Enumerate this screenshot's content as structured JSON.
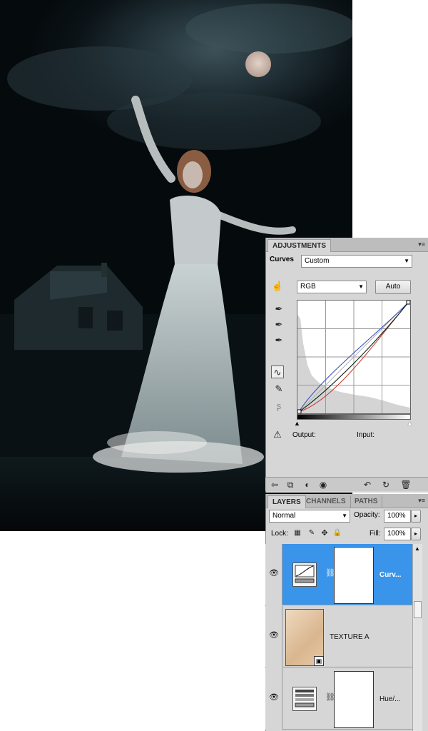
{
  "colors": {
    "panel_bg": "#d6d6d6",
    "selected_layer": "#3a94ea",
    "curve_rgb": "#1a1a1a",
    "curve_red": "#c0392b",
    "curve_green": "#27ae60",
    "curve_blue": "#2e4bb8"
  },
  "adjustments": {
    "tab_label": "ADJUSTMENTS",
    "preset_label": "Curves",
    "preset_value": "Custom",
    "channel_value": "RGB",
    "auto_button": "Auto",
    "output_label": "Output:",
    "input_label": "Input:"
  },
  "layers": {
    "tabs": [
      "LAYERS",
      "CHANNELS",
      "PATHS"
    ],
    "blend_mode": "Normal",
    "opacity_label": "Opacity:",
    "opacity_value": "100%",
    "lock_label": "Lock:",
    "fill_label": "Fill:",
    "fill_value": "100%",
    "items": [
      {
        "name": "Curv...",
        "kind": "curves-adjustment",
        "selected": true
      },
      {
        "name": "TEXTURE A",
        "kind": "smart-object",
        "selected": false
      },
      {
        "name": "Hue/...",
        "kind": "hue-saturation-adjustment",
        "selected": false
      }
    ]
  },
  "icons": {
    "eye": "eye-icon",
    "chain": "link-icon",
    "panel_menu": "panel-menu-icon"
  }
}
